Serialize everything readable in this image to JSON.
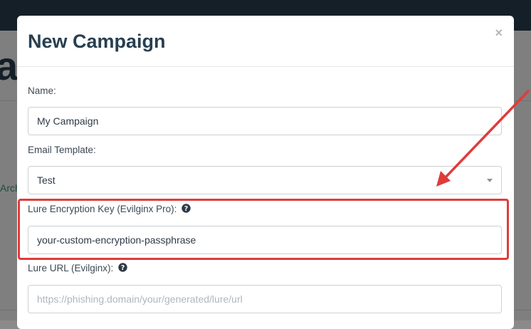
{
  "background": {
    "heading_fragment": "ai",
    "tab_fragment": "Arch"
  },
  "modal": {
    "title": "New Campaign",
    "close_label": "×",
    "fields": {
      "name": {
        "label": "Name:",
        "value": "My Campaign"
      },
      "email_template": {
        "label": "Email Template:",
        "selected": "Test"
      },
      "lure_encryption_key": {
        "label": "Lure Encryption Key (Evilginx Pro):",
        "value": "your-custom-encryption-passphrase"
      },
      "lure_url": {
        "label": "Lure URL (Evilginx):",
        "value": "",
        "placeholder": "https://phishing.domain/your/generated/lure/url"
      }
    }
  },
  "icons": {
    "help": "question-circle-icon",
    "caret": "chevron-down-icon",
    "close": "close-icon"
  },
  "colors": {
    "navbar": "#283f50",
    "title": "#283f50",
    "highlight": "#e03b3b",
    "accent": "#37a085"
  }
}
